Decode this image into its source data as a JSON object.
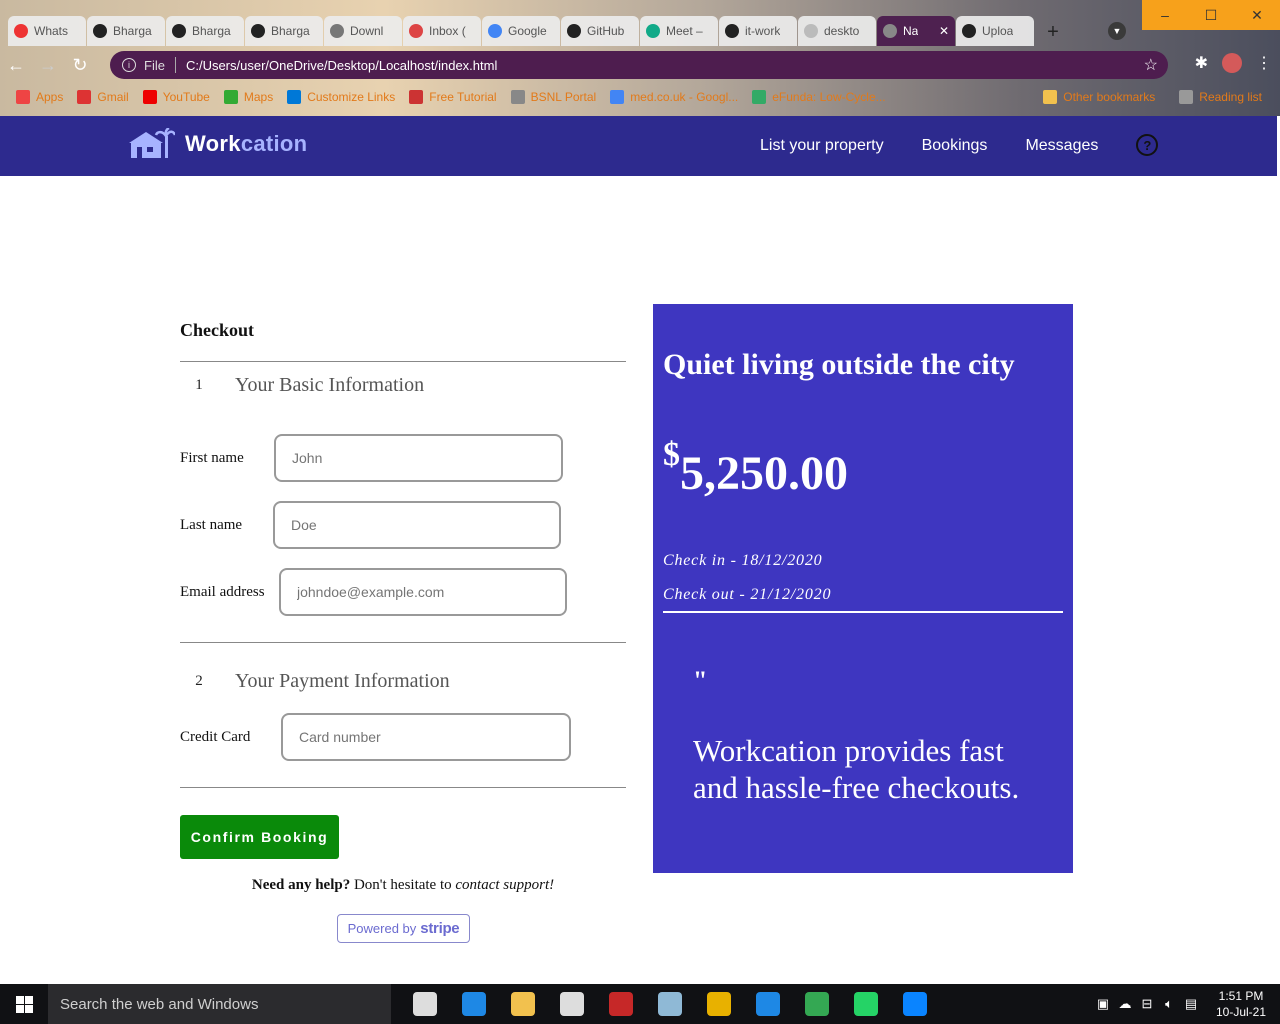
{
  "browser": {
    "tabs": [
      {
        "title": "Whats",
        "icon": "whatsapp-icon",
        "color": "#e33"
      },
      {
        "title": "Bharga",
        "icon": "github-icon",
        "color": "#222"
      },
      {
        "title": "Bharga",
        "icon": "github-icon",
        "color": "#222"
      },
      {
        "title": "Bharga",
        "icon": "github-icon",
        "color": "#222"
      },
      {
        "title": "Downl",
        "icon": "download-icon",
        "color": "#777"
      },
      {
        "title": "Inbox (",
        "icon": "gmail-icon",
        "color": "#d44"
      },
      {
        "title": "Google",
        "icon": "google-icon",
        "color": "#4285f4"
      },
      {
        "title": "GitHub",
        "icon": "github-icon",
        "color": "#222"
      },
      {
        "title": "Meet –",
        "icon": "meet-icon",
        "color": "#1a8"
      },
      {
        "title": "it-work",
        "icon": "github-icon",
        "color": "#222"
      },
      {
        "title": "deskto",
        "icon": "globe-icon",
        "color": "#bbb"
      },
      {
        "title": "Na",
        "icon": "globe-icon",
        "color": "#888",
        "active": true
      },
      {
        "title": "Uploa",
        "icon": "github-icon",
        "color": "#222"
      }
    ],
    "newtab": "+",
    "window_controls": [
      "–",
      "☐",
      "✕"
    ],
    "address": {
      "file_label": "File",
      "url": "C:/Users/user/OneDrive/Desktop/Localhost/index.html"
    },
    "bookmarks": [
      {
        "label": "Apps",
        "color": "#e44"
      },
      {
        "label": "Gmail",
        "color": "#d33"
      },
      {
        "label": "YouTube",
        "color": "#e00"
      },
      {
        "label": "Maps",
        "color": "#3a3"
      },
      {
        "label": "Customize Links",
        "color": "#0078d7"
      },
      {
        "label": "Free Tutorial",
        "color": "#c33"
      },
      {
        "label": "BSNL Portal",
        "color": "#888"
      },
      {
        "label": "med.co.uk - Googl...",
        "color": "#4285f4"
      },
      {
        "label": "eFunda: Low-Cycle...",
        "color": "#3a6"
      }
    ],
    "bookmarks_right": [
      "Other bookmarks",
      "Reading list"
    ]
  },
  "navbar": {
    "brand_main": "Work",
    "brand_light": "cation",
    "links": [
      "List your property",
      "Bookings",
      "Messages"
    ],
    "help": "?"
  },
  "checkout": {
    "title": "Checkout",
    "step1": {
      "num": "1",
      "title": "Your Basic Information"
    },
    "fields": {
      "first_name": {
        "label": "First name",
        "placeholder": "John"
      },
      "last_name": {
        "label": "Last name",
        "placeholder": "Doe"
      },
      "email": {
        "label": "Email address",
        "placeholder": "johndoe@example.com"
      },
      "card": {
        "label": "Credit Card",
        "placeholder": "Card number"
      }
    },
    "step2": {
      "num": "2",
      "title": "Your Payment Information"
    },
    "confirm_label": "Confirm Booking",
    "help": {
      "bold": "Need any help?",
      "plain": " Don't hesitate to ",
      "italic": "contact support!"
    },
    "stripe": {
      "powered": "Powered by",
      "brand": "stripe"
    }
  },
  "summary": {
    "title": "Quiet living outside the city",
    "currency": "$",
    "amount": "5,250.00",
    "check_in": "Check in - 18/12/2020",
    "check_out": "Check out - 21/12/2020",
    "quote_mark": "\"",
    "quote": "Workcation provides fast and hassle-free checkouts."
  },
  "taskbar": {
    "search_placeholder": "Search the web and Windows",
    "apps": [
      {
        "name": "task-view",
        "color": "#ddd"
      },
      {
        "name": "edge",
        "color": "#1e88e5"
      },
      {
        "name": "file-explorer",
        "color": "#f2c14e"
      },
      {
        "name": "store",
        "color": "#ddd"
      },
      {
        "name": "acrobat",
        "color": "#c62828"
      },
      {
        "name": "notes",
        "color": "#8fb9d6"
      },
      {
        "name": "chrome",
        "color": "#e8b100"
      },
      {
        "name": "settings",
        "color": "#1e88e5"
      },
      {
        "name": "chrome-profile",
        "color": "#34a853"
      },
      {
        "name": "whatsapp",
        "color": "#25d366"
      },
      {
        "name": "vscode",
        "color": "#0a84ff"
      }
    ],
    "time": "1:51 PM",
    "date": "10-Jul-21"
  }
}
